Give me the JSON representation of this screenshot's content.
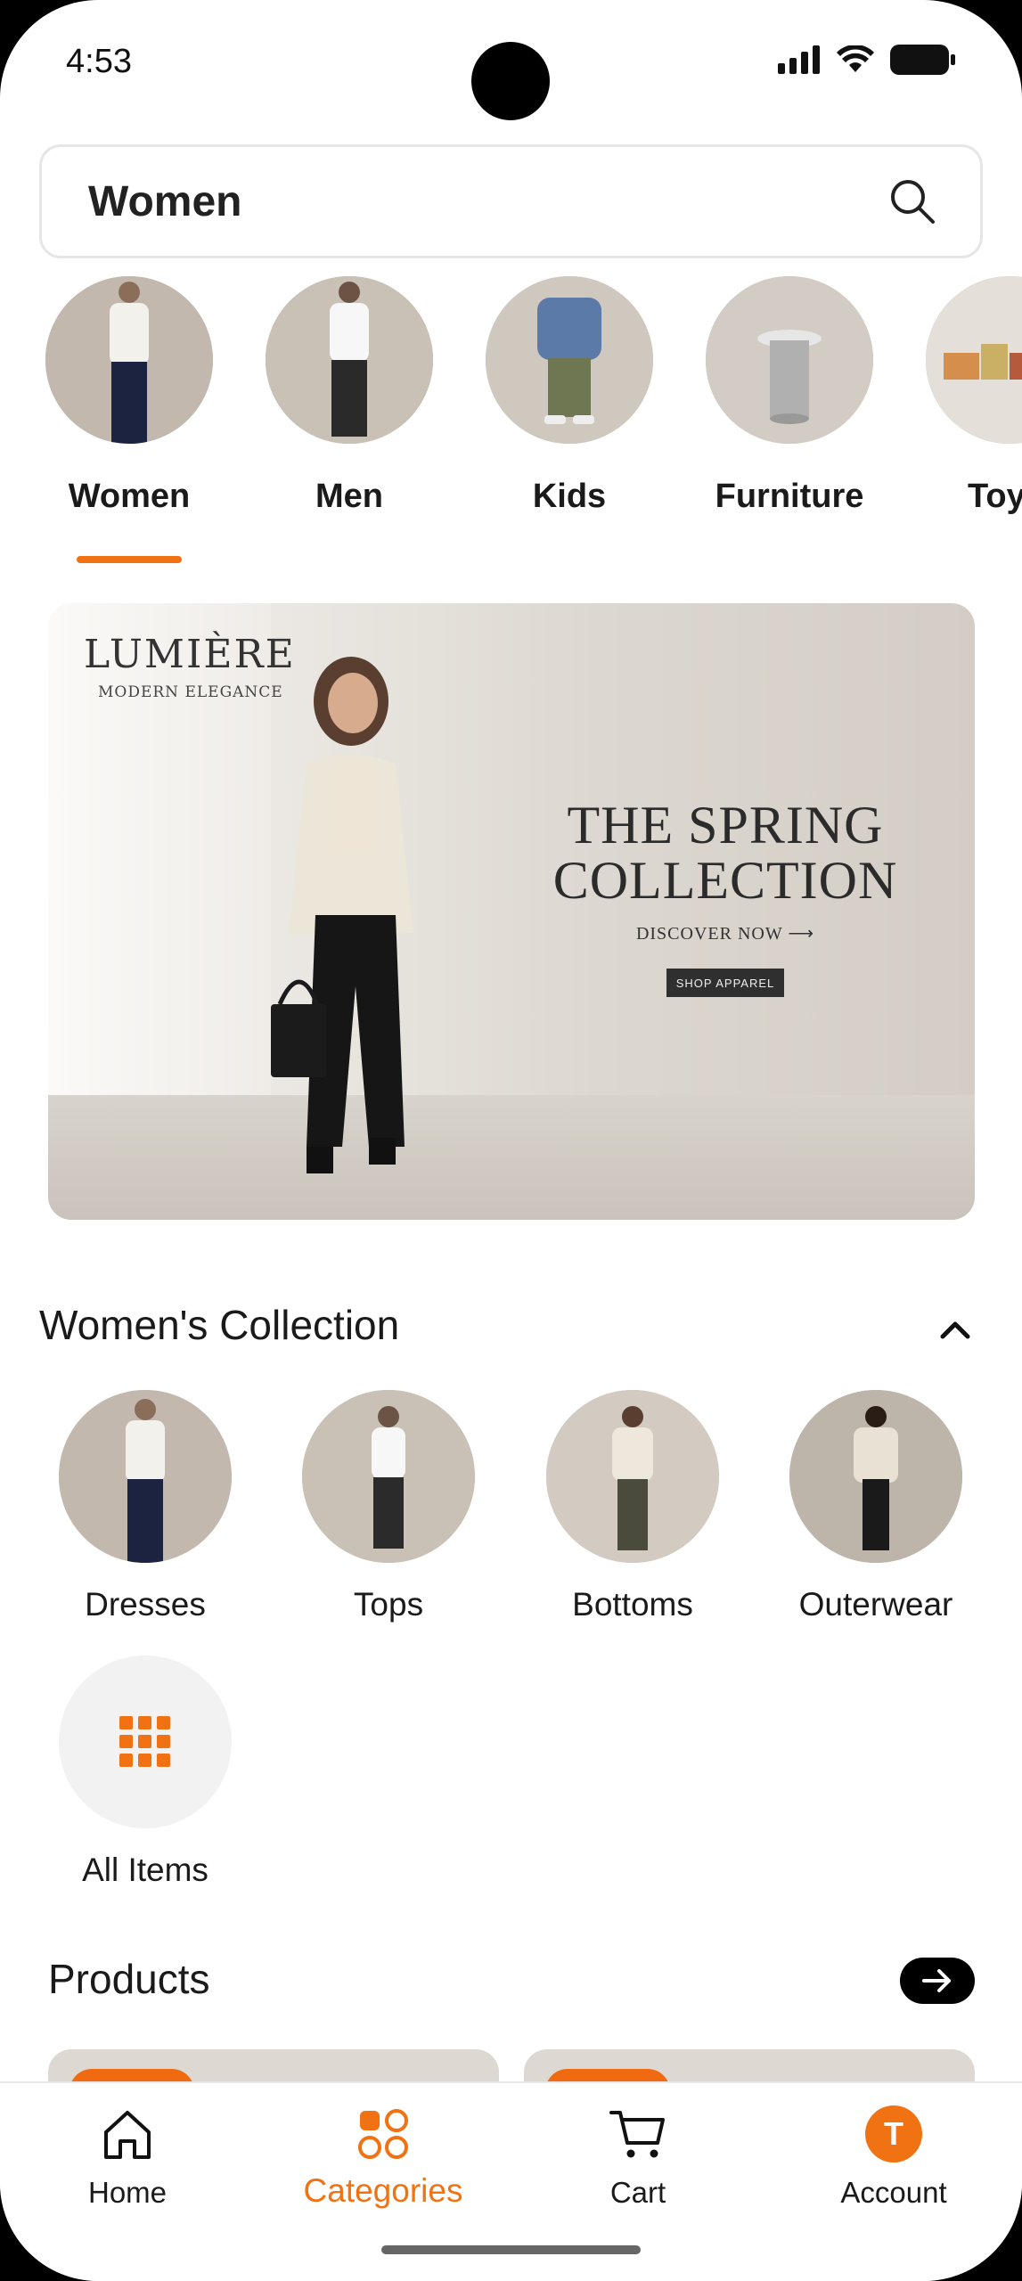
{
  "status_bar": {
    "time": "4:53"
  },
  "search": {
    "value": "Women",
    "icon": "search-icon"
  },
  "categories": [
    {
      "label": "Women",
      "selected": true
    },
    {
      "label": "Men",
      "selected": false
    },
    {
      "label": "Kids",
      "selected": false
    },
    {
      "label": "Furniture",
      "selected": false
    },
    {
      "label": "Toy",
      "selected": false
    }
  ],
  "banner": {
    "brand": "LUMIÈRE",
    "tagline": "MODERN ELEGANCE",
    "headline_line1": "THE SPRING",
    "headline_line2": "COLLECTION",
    "discover": "DISCOVER NOW ⟶",
    "cta": "SHOP APPAREL"
  },
  "collection": {
    "title": "Women's Collection",
    "toggle_icon": "chevron-up-icon",
    "items": [
      {
        "label": "Dresses"
      },
      {
        "label": "Tops"
      },
      {
        "label": "Bottoms"
      },
      {
        "label": "Outerwear"
      },
      {
        "label": "All Items",
        "icon": "grid-icon"
      }
    ]
  },
  "products": {
    "title": "Products",
    "arrow_icon": "arrow-right-icon"
  },
  "bottom_nav": {
    "items": [
      {
        "label": "Home",
        "icon": "home-icon"
      },
      {
        "label": "Categories",
        "icon": "categories-icon",
        "active": true
      },
      {
        "label": "Cart",
        "icon": "cart-icon"
      },
      {
        "label": "Account",
        "icon": "account-avatar",
        "avatar_letter": "T"
      }
    ]
  },
  "colors": {
    "accent": "#f07213",
    "text": "#1a1a1a",
    "border": "#e6e6e6"
  }
}
